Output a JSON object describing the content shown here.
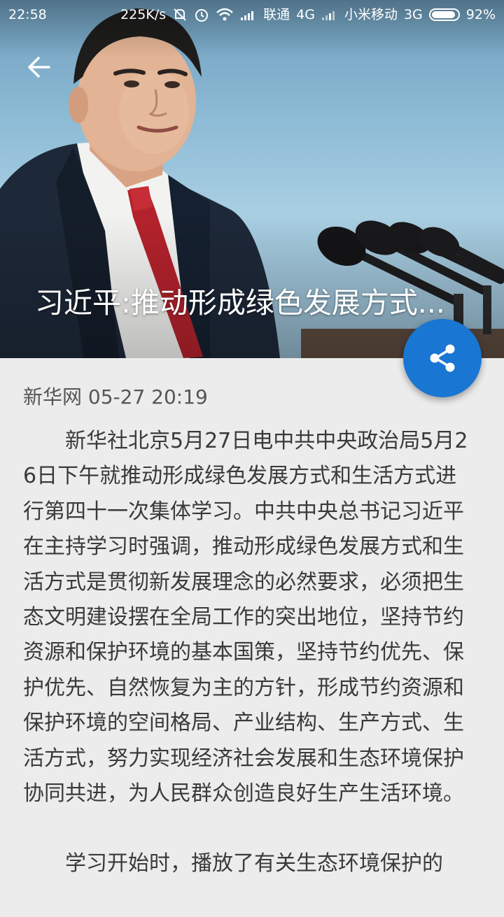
{
  "status_bar": {
    "time": "22:58",
    "net_speed": "225K/s",
    "carrier1": "联通",
    "net1": "4G",
    "carrier2": "小米移动",
    "net2": "3G",
    "battery_text": "92%",
    "battery_level": 0.92
  },
  "hero": {
    "title": "习近平:推动形成绿色发展方式..."
  },
  "article": {
    "source_line": "新华网 05-27 20:19",
    "paragraphs": [
      "新华社北京5月27日电中共中央政治局5月26日下午就推动形成绿色发展方式和生活方式进行第四十一次集体学习。中共中央总书记习近平在主持学习时强调，推动形成绿色发展方式和生活方式是贯彻新发展理念的必然要求，必须把生态文明建设摆在全局工作的突出地位，坚持节约资源和保护环境的基本国策，坚持节约优先、保护优先、自然恢复为主的方针，形成节约资源和保护环境的空间格局、产业结构、生产方式、生活方式，努力实现经济社会发展和生态环境保护协同共进，为人民群众创造良好生产生活环境。",
      "学习开始时，播放了有关生态环境保护的"
    ]
  },
  "icons": {
    "back": "arrow-back-icon",
    "share": "share-icon",
    "mute": "mute-icon",
    "alarm": "alarm-icon",
    "wifi": "wifi-icon",
    "signal": "signal-icon"
  },
  "colors": {
    "fab": "#1976d2",
    "background": "#ececec",
    "text": "#3a3a3a"
  }
}
